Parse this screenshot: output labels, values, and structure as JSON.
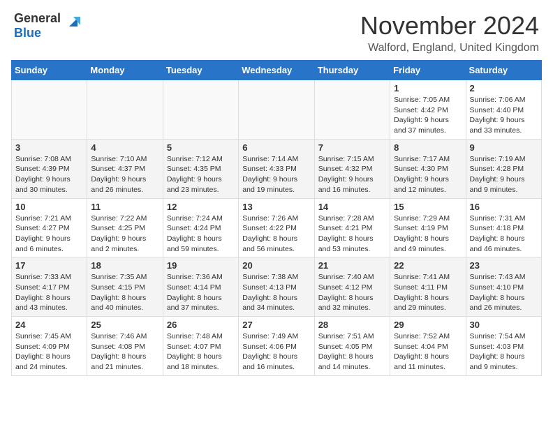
{
  "header": {
    "logo_general": "General",
    "logo_blue": "Blue",
    "month_title": "November 2024",
    "location": "Walford, England, United Kingdom"
  },
  "calendar": {
    "days_of_week": [
      "Sunday",
      "Monday",
      "Tuesday",
      "Wednesday",
      "Thursday",
      "Friday",
      "Saturday"
    ],
    "weeks": [
      [
        {
          "day": "",
          "info": ""
        },
        {
          "day": "",
          "info": ""
        },
        {
          "day": "",
          "info": ""
        },
        {
          "day": "",
          "info": ""
        },
        {
          "day": "",
          "info": ""
        },
        {
          "day": "1",
          "info": "Sunrise: 7:05 AM\nSunset: 4:42 PM\nDaylight: 9 hours and 37 minutes."
        },
        {
          "day": "2",
          "info": "Sunrise: 7:06 AM\nSunset: 4:40 PM\nDaylight: 9 hours and 33 minutes."
        }
      ],
      [
        {
          "day": "3",
          "info": "Sunrise: 7:08 AM\nSunset: 4:39 PM\nDaylight: 9 hours and 30 minutes."
        },
        {
          "day": "4",
          "info": "Sunrise: 7:10 AM\nSunset: 4:37 PM\nDaylight: 9 hours and 26 minutes."
        },
        {
          "day": "5",
          "info": "Sunrise: 7:12 AM\nSunset: 4:35 PM\nDaylight: 9 hours and 23 minutes."
        },
        {
          "day": "6",
          "info": "Sunrise: 7:14 AM\nSunset: 4:33 PM\nDaylight: 9 hours and 19 minutes."
        },
        {
          "day": "7",
          "info": "Sunrise: 7:15 AM\nSunset: 4:32 PM\nDaylight: 9 hours and 16 minutes."
        },
        {
          "day": "8",
          "info": "Sunrise: 7:17 AM\nSunset: 4:30 PM\nDaylight: 9 hours and 12 minutes."
        },
        {
          "day": "9",
          "info": "Sunrise: 7:19 AM\nSunset: 4:28 PM\nDaylight: 9 hours and 9 minutes."
        }
      ],
      [
        {
          "day": "10",
          "info": "Sunrise: 7:21 AM\nSunset: 4:27 PM\nDaylight: 9 hours and 6 minutes."
        },
        {
          "day": "11",
          "info": "Sunrise: 7:22 AM\nSunset: 4:25 PM\nDaylight: 9 hours and 2 minutes."
        },
        {
          "day": "12",
          "info": "Sunrise: 7:24 AM\nSunset: 4:24 PM\nDaylight: 8 hours and 59 minutes."
        },
        {
          "day": "13",
          "info": "Sunrise: 7:26 AM\nSunset: 4:22 PM\nDaylight: 8 hours and 56 minutes."
        },
        {
          "day": "14",
          "info": "Sunrise: 7:28 AM\nSunset: 4:21 PM\nDaylight: 8 hours and 53 minutes."
        },
        {
          "day": "15",
          "info": "Sunrise: 7:29 AM\nSunset: 4:19 PM\nDaylight: 8 hours and 49 minutes."
        },
        {
          "day": "16",
          "info": "Sunrise: 7:31 AM\nSunset: 4:18 PM\nDaylight: 8 hours and 46 minutes."
        }
      ],
      [
        {
          "day": "17",
          "info": "Sunrise: 7:33 AM\nSunset: 4:17 PM\nDaylight: 8 hours and 43 minutes."
        },
        {
          "day": "18",
          "info": "Sunrise: 7:35 AM\nSunset: 4:15 PM\nDaylight: 8 hours and 40 minutes."
        },
        {
          "day": "19",
          "info": "Sunrise: 7:36 AM\nSunset: 4:14 PM\nDaylight: 8 hours and 37 minutes."
        },
        {
          "day": "20",
          "info": "Sunrise: 7:38 AM\nSunset: 4:13 PM\nDaylight: 8 hours and 34 minutes."
        },
        {
          "day": "21",
          "info": "Sunrise: 7:40 AM\nSunset: 4:12 PM\nDaylight: 8 hours and 32 minutes."
        },
        {
          "day": "22",
          "info": "Sunrise: 7:41 AM\nSunset: 4:11 PM\nDaylight: 8 hours and 29 minutes."
        },
        {
          "day": "23",
          "info": "Sunrise: 7:43 AM\nSunset: 4:10 PM\nDaylight: 8 hours and 26 minutes."
        }
      ],
      [
        {
          "day": "24",
          "info": "Sunrise: 7:45 AM\nSunset: 4:09 PM\nDaylight: 8 hours and 24 minutes."
        },
        {
          "day": "25",
          "info": "Sunrise: 7:46 AM\nSunset: 4:08 PM\nDaylight: 8 hours and 21 minutes."
        },
        {
          "day": "26",
          "info": "Sunrise: 7:48 AM\nSunset: 4:07 PM\nDaylight: 8 hours and 18 minutes."
        },
        {
          "day": "27",
          "info": "Sunrise: 7:49 AM\nSunset: 4:06 PM\nDaylight: 8 hours and 16 minutes."
        },
        {
          "day": "28",
          "info": "Sunrise: 7:51 AM\nSunset: 4:05 PM\nDaylight: 8 hours and 14 minutes."
        },
        {
          "day": "29",
          "info": "Sunrise: 7:52 AM\nSunset: 4:04 PM\nDaylight: 8 hours and 11 minutes."
        },
        {
          "day": "30",
          "info": "Sunrise: 7:54 AM\nSunset: 4:03 PM\nDaylight: 8 hours and 9 minutes."
        }
      ]
    ]
  }
}
